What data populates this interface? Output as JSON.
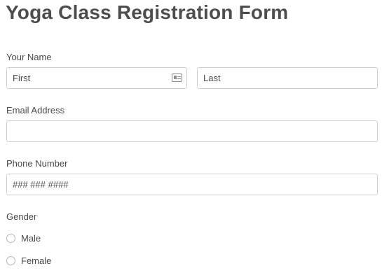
{
  "form": {
    "title": "Yoga Class Registration Form",
    "name": {
      "label": "Your Name",
      "first_placeholder": "First",
      "last_placeholder": "Last"
    },
    "email": {
      "label": "Email Address",
      "placeholder": ""
    },
    "phone": {
      "label": "Phone Number",
      "placeholder": "### ### ####"
    },
    "gender": {
      "label": "Gender",
      "options": [
        "Male",
        "Female"
      ]
    }
  },
  "icons": {
    "name_field_icon": "contact-card-icon"
  },
  "colors": {
    "border": "#cfcfcf",
    "text": "#4a4a4a",
    "title": "#4d4d4d"
  }
}
